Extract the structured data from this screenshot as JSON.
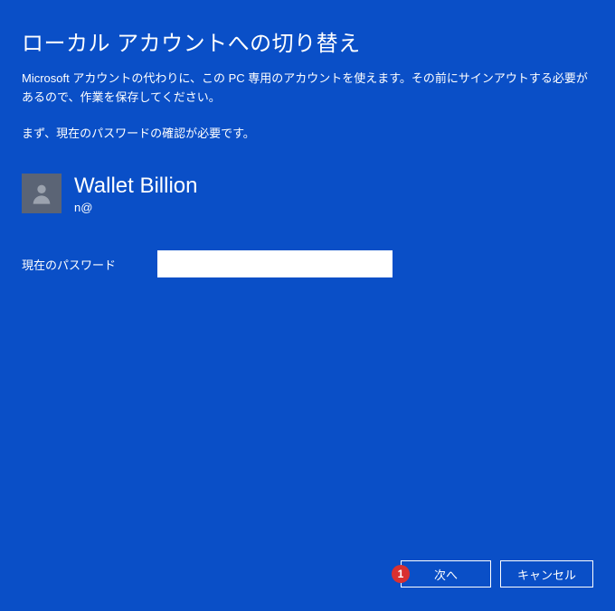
{
  "title": "ローカル アカウントへの切り替え",
  "description": "Microsoft アカウントの代わりに、この PC 専用のアカウントを使えます。その前にサインアウトする必要があるので、作業を保存してください。",
  "instruction": "まず、現在のパスワードの確認が必要です。",
  "user": {
    "name": "Wallet Billion",
    "email": "n@"
  },
  "form": {
    "password_label": "現在のパスワード",
    "password_value": ""
  },
  "buttons": {
    "next": "次へ",
    "cancel": "キャンセル"
  },
  "badge": "1"
}
